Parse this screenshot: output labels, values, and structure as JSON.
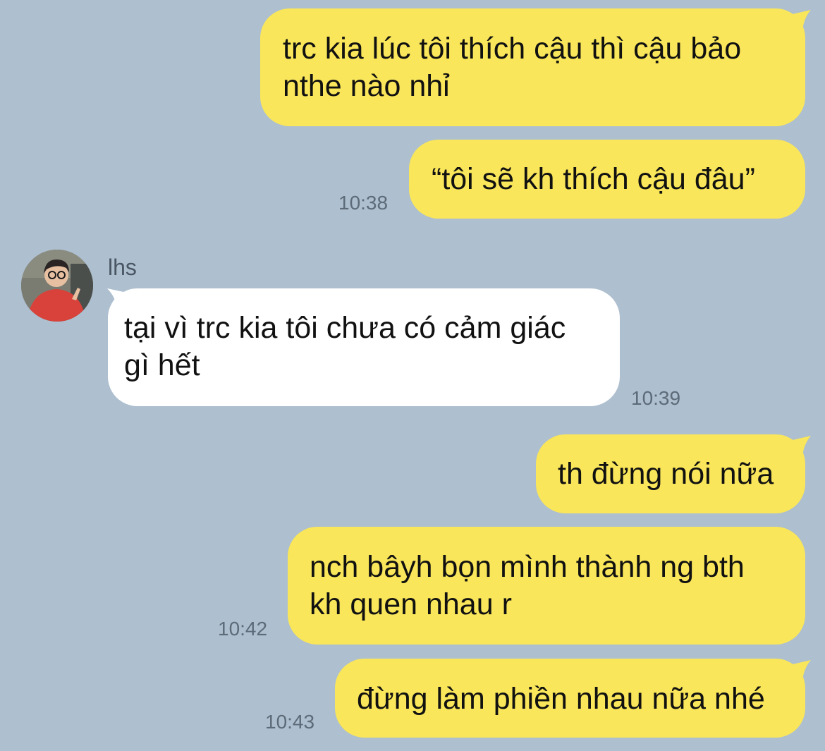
{
  "colors": {
    "background": "#aebfcf",
    "outgoing_bubble": "#f9e65a",
    "incoming_bubble": "#ffffff",
    "time_text": "#5d6b79"
  },
  "contact": {
    "name": "lhs",
    "avatar_icon": "avatar-photo"
  },
  "messages": [
    {
      "direction": "outgoing",
      "lines": [
        "trc kia lúc tôi thích cậu thì cậu bảo",
        "nthe nào nhỉ"
      ],
      "time": ""
    },
    {
      "direction": "outgoing",
      "lines": [
        "“tôi sẽ kh thích cậu đâu”"
      ],
      "time": "10:38"
    },
    {
      "direction": "incoming",
      "lines": [
        "tại vì trc kia tôi chưa có cảm giác",
        "gì hết"
      ],
      "time": "10:39"
    },
    {
      "direction": "outgoing",
      "lines": [
        "th đừng nói nữa"
      ],
      "time": ""
    },
    {
      "direction": "outgoing",
      "lines": [
        "nch bâyh bọn mình thành ng bth",
        "kh quen nhau r"
      ],
      "time": "10:42"
    },
    {
      "direction": "outgoing",
      "lines": [
        "đừng làm phiền nhau nữa nhé"
      ],
      "time": "10:43"
    }
  ]
}
